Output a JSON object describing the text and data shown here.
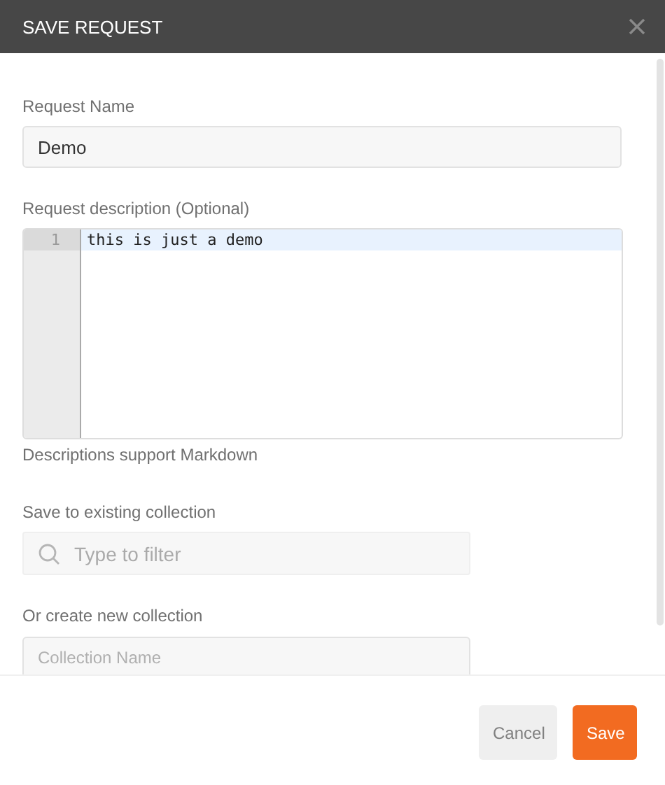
{
  "dialog": {
    "title": "SAVE REQUEST"
  },
  "request_name": {
    "label": "Request Name",
    "value": "Demo"
  },
  "description": {
    "label": "Request description (Optional)",
    "lines": [
      {
        "number": "1",
        "text": "this is just a demo",
        "active": true
      }
    ],
    "hint": "Descriptions support Markdown"
  },
  "existing_collection": {
    "label": "Save to existing collection",
    "placeholder": "Type to filter"
  },
  "new_collection": {
    "label": "Or create new collection",
    "placeholder": "Collection Name"
  },
  "buttons": [
    {
      "label": "Cancel",
      "kind": "secondary"
    },
    {
      "label": "Save",
      "kind": "primary"
    }
  ]
}
